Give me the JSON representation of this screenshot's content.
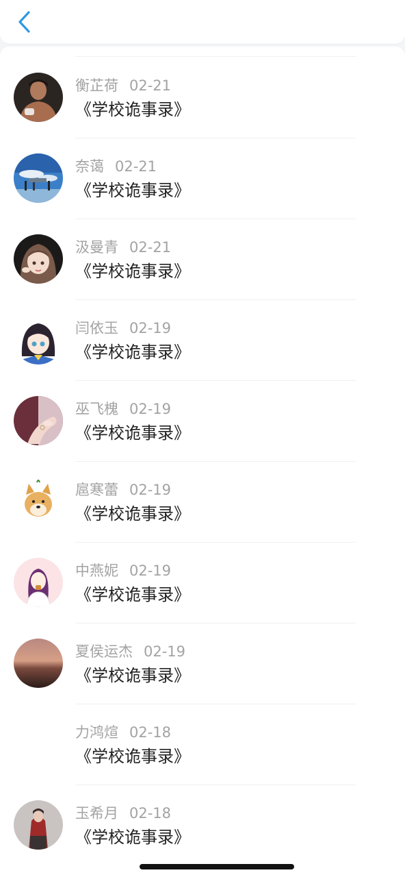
{
  "header": {
    "back_icon": "chevron-left-icon",
    "accent_color": "#2f9ae0"
  },
  "comments": [
    {
      "name": "衡芷荷",
      "date": "02-21",
      "title": "《学校诡事录》",
      "avatar": "man-portrait"
    },
    {
      "name": "奈蔼",
      "date": "02-21",
      "title": "《学校诡事录》",
      "avatar": "sky-people"
    },
    {
      "name": "汲曼青",
      "date": "02-21",
      "title": "《学校诡事录》",
      "avatar": "anime-girl-brown"
    },
    {
      "name": "闫依玉",
      "date": "02-19",
      "title": "《学校诡事录》",
      "avatar": "anime-girl-blue"
    },
    {
      "name": "巫飞槐",
      "date": "02-19",
      "title": "《学校诡事录》",
      "avatar": "hand-ring"
    },
    {
      "name": "扈寒蕾",
      "date": "02-19",
      "title": "《学校诡事录》",
      "avatar": "shiba-doge"
    },
    {
      "name": "中燕妮",
      "date": "02-19",
      "title": "《学校诡事录》",
      "avatar": "purple-hair-girl"
    },
    {
      "name": "夏侯运杰",
      "date": "02-19",
      "title": "《学校诡事录》",
      "avatar": "sunset"
    },
    {
      "name": "力鸿煊",
      "date": "02-18",
      "title": "《学校诡事录》",
      "avatar": "none"
    },
    {
      "name": "玉希月",
      "date": "02-18",
      "title": "《学校诡事录》",
      "avatar": "red-outfit-person"
    }
  ]
}
